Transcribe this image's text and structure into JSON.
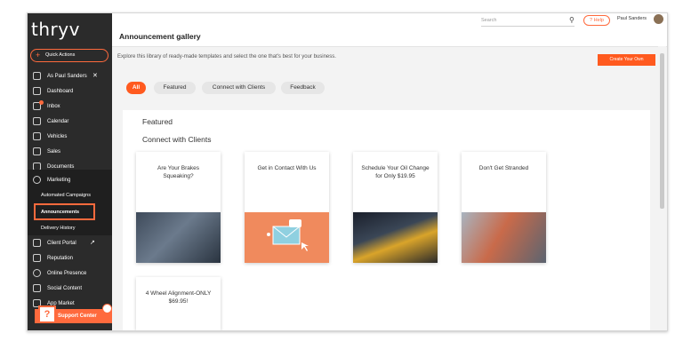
{
  "sidebar": {
    "logo": "thryv",
    "quick_actions": "Quick Actions",
    "items": [
      {
        "label": "As Paul Sanders",
        "icon": "user-icon"
      },
      {
        "label": "Dashboard",
        "icon": "dashboard-icon"
      },
      {
        "label": "Inbox",
        "icon": "inbox-icon"
      },
      {
        "label": "Calendar",
        "icon": "calendar-icon"
      },
      {
        "label": "Vehicles",
        "icon": "vehicle-icon"
      },
      {
        "label": "Sales",
        "icon": "sales-icon"
      },
      {
        "label": "Documents",
        "icon": "documents-icon"
      },
      {
        "label": "Marketing",
        "icon": "marketing-icon"
      },
      {
        "label": "Client Portal",
        "icon": "portal-icon"
      },
      {
        "label": "Reputation",
        "icon": "reputation-icon"
      },
      {
        "label": "Online Presence",
        "icon": "globe-icon"
      },
      {
        "label": "Social Content",
        "icon": "social-icon"
      },
      {
        "label": "App Market",
        "icon": "app-market-icon"
      }
    ],
    "submenu": [
      "Automated Campaigns",
      "Announcements",
      "Delivery History"
    ],
    "support": "Support Center"
  },
  "header": {
    "search_placeholder": "Search",
    "help": "? Help",
    "user": "Paul Sanders",
    "title": "Announcement gallery"
  },
  "main": {
    "description": "Explore this library of ready-made templates and select the one that's best for your business.",
    "create_button": "Create Your Own",
    "filters": [
      "All",
      "Featured",
      "Connect with Clients",
      "Feedback"
    ],
    "section_featured": "Featured",
    "section_connect": "Connect with Clients",
    "cards": [
      {
        "title": "Are Your Brakes Squeaking?"
      },
      {
        "title": "Get in Contact With Us"
      },
      {
        "title": "Schedule Your Oil Change for Only $19.95"
      },
      {
        "title": "Don't Get Stranded"
      },
      {
        "title": "4 Wheel Alignment-ONLY $69.95!"
      }
    ]
  },
  "colors": {
    "accent": "#ff5a1f",
    "sidebar": "#2b2b2b"
  }
}
